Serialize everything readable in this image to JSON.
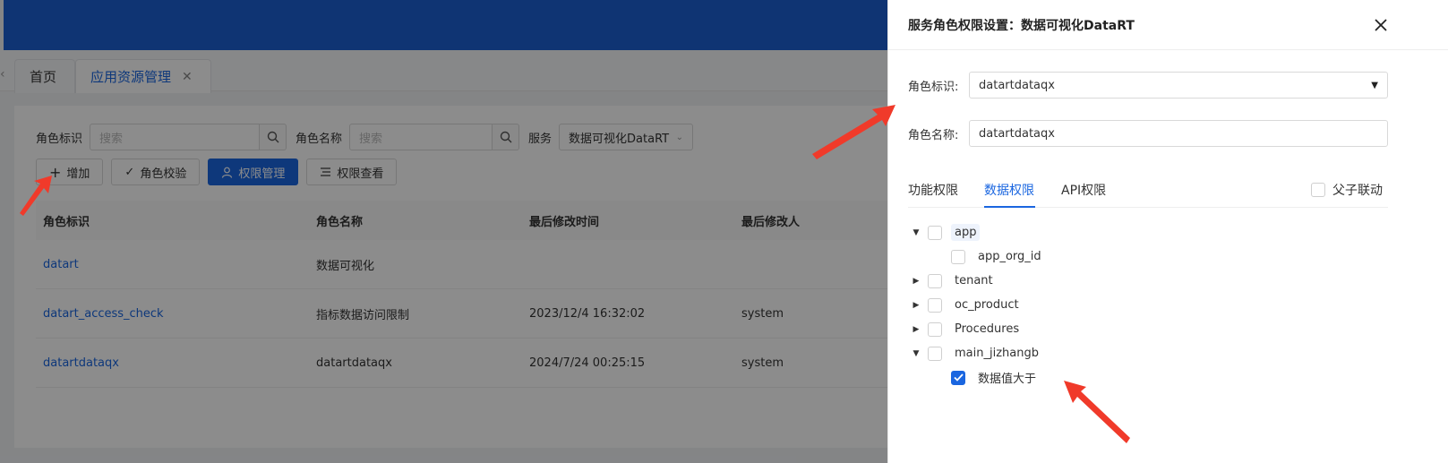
{
  "tabs": {
    "home": "首页",
    "active": "应用资源管理"
  },
  "filters": {
    "role_id_label": "角色标识",
    "role_id_placeholder": "搜索",
    "role_name_label": "角色名称",
    "role_name_placeholder": "搜索",
    "service_label": "服务",
    "service_value": "数据可视化DataRT"
  },
  "toolbar": {
    "add": "增加",
    "verify": "角色校验",
    "permission_manage": "权限管理",
    "permission_view": "权限查看"
  },
  "table": {
    "headers": [
      "角色标识",
      "角色名称",
      "最后修改时间",
      "最后修改人"
    ],
    "rows": [
      [
        "datart",
        "数据可视化",
        "",
        ""
      ],
      [
        "datart_access_check",
        "指标数据访问限制",
        "2023/12/4 16:32:02",
        "system"
      ],
      [
        "datartdataqx",
        "datartdataqx",
        "2024/7/24 00:25:15",
        "system"
      ]
    ]
  },
  "drawer": {
    "title": "服务角色权限设置：数据可视化DataRT",
    "role_id_label": "角色标识:",
    "role_id_value": "datartdataqx",
    "role_name_label": "角色名称:",
    "role_name_value": "datartdataqx",
    "tabs": [
      "功能权限",
      "数据权限",
      "API权限"
    ],
    "active_tab": "数据权限",
    "linkage_label": "父子联动",
    "tree": [
      {
        "label": "app",
        "expanded": true,
        "level": 0,
        "checked": false
      },
      {
        "label": "app_org_id",
        "level": 1,
        "checked": false
      },
      {
        "label": "tenant",
        "expanded": false,
        "level": 0,
        "checked": false
      },
      {
        "label": "oc_product",
        "expanded": false,
        "level": 0,
        "checked": false
      },
      {
        "label": "Procedures",
        "expanded": false,
        "level": 0,
        "checked": false
      },
      {
        "label": "main_jizhangb",
        "expanded": true,
        "level": 0,
        "checked": false
      },
      {
        "label": "数据值大于",
        "level": 1,
        "checked": true
      }
    ]
  },
  "colors": {
    "primary": "#1a66e0",
    "topbar": "#1c5fd2",
    "annotation_arrow": "#f03a2a"
  }
}
